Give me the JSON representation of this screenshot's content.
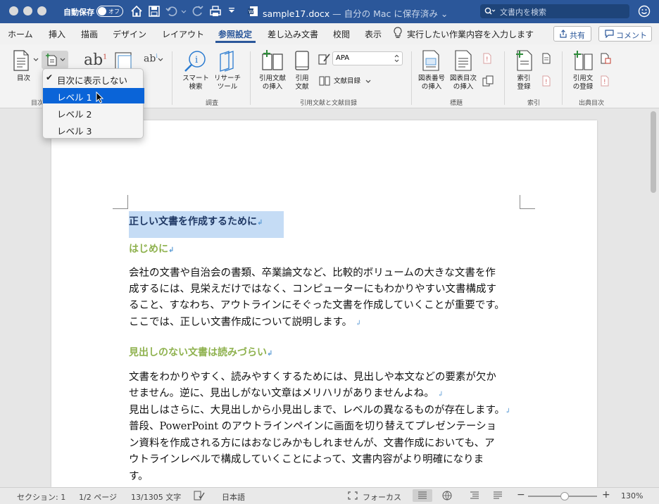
{
  "titlebar": {
    "autosave_label": "自動保存",
    "autosave_state": "オフ",
    "doc_name": "sample17.docx",
    "doc_location": " — 自分の Mac に保存済み",
    "search_placeholder": "文書内を検索"
  },
  "tabs": [
    {
      "label": "ホーム"
    },
    {
      "label": "挿入"
    },
    {
      "label": "描画"
    },
    {
      "label": "デザイン"
    },
    {
      "label": "レイアウト"
    },
    {
      "label": "参照設定"
    },
    {
      "label": "差し込み文書"
    },
    {
      "label": "校閲"
    },
    {
      "label": "表示"
    }
  ],
  "active_tab": "参照設定",
  "tell_me": "実行したい作業内容を入力します",
  "share_label": "共有",
  "comment_label": "コメント",
  "ribbon": {
    "toc_label": "目次",
    "toc_group": "目次",
    "smart_lookup": "スマート検索",
    "smart_lookup_1": "スマート",
    "smart_lookup_2": "検索",
    "researcher_1": "リサーチ",
    "researcher_2": "ツール",
    "research_group": "調査",
    "insert_citation_1": "引用文献",
    "insert_citation_2": "の挿入",
    "citation_1": "引用",
    "citation_2": "文献",
    "style_value": "APA",
    "bibliography": "文献目録",
    "citations_group": "引用文献と文献目録",
    "insert_caption_1": "図表番号",
    "insert_caption_2": "の挿入",
    "insert_tof_1": "図表目次",
    "insert_tof_2": "の挿入",
    "captions_group": "標題",
    "mark_entry_1": "索引",
    "mark_entry_2": "登録",
    "index_group": "索引",
    "mark_citation_1": "引用文",
    "mark_citation_2": "の登録",
    "toa_group": "出典目次"
  },
  "menu": {
    "items": [
      {
        "label": "目次に表示しない",
        "checked": true
      },
      {
        "label": "レベル 1",
        "selected": true
      },
      {
        "label": "レベル 2"
      },
      {
        "label": "レベル 3"
      }
    ]
  },
  "document": {
    "heading1": "正しい文書を作成するために",
    "heading2a": "はじめに",
    "para1": [
      "会社の文書や自治会の書類、卒業論文など、比較的ボリュームの大きな文書を作",
      "成するには、見栄えだけではなく、コンピューターにもわかりやすい文書構成す",
      "ること、すなわち、アウトラインにそぐった文書を作成していくことが重要です。",
      "ここでは、正しい文書作成について説明します。"
    ],
    "heading2b": "見出しのない文書は読みづらい",
    "para2": [
      "文書をわかりやすく、読みやすくするためには、見出しや本文などの要素が欠か",
      "せません。逆に、見出しがない文章はメリハリがありませんよね。",
      "見出しはさらに、大見出しから小見出しまで、レベルの異なるものが存在します。",
      "普段、PowerPoint のアウトラインペインに画面を切り替えてプレゼンテーショ",
      "ン資料を作成される方にはおなじみかもしれませんが、文書作成においても、ア",
      "ウトラインレベルで構成していくことによって、文書内容がより明確になりま",
      "す。"
    ]
  },
  "status": {
    "section": "セクション: 1",
    "page": "1/2 ページ",
    "words": "13/1305 文字",
    "language": "日本語",
    "focus": "フォーカス",
    "zoom": "130%"
  },
  "colors": {
    "titlebar": "#2b579a",
    "heading1": "#1f3864",
    "heading2": "#8fb24f",
    "selection": "#c5dcf5",
    "menu_selected": "#0a64d8"
  }
}
